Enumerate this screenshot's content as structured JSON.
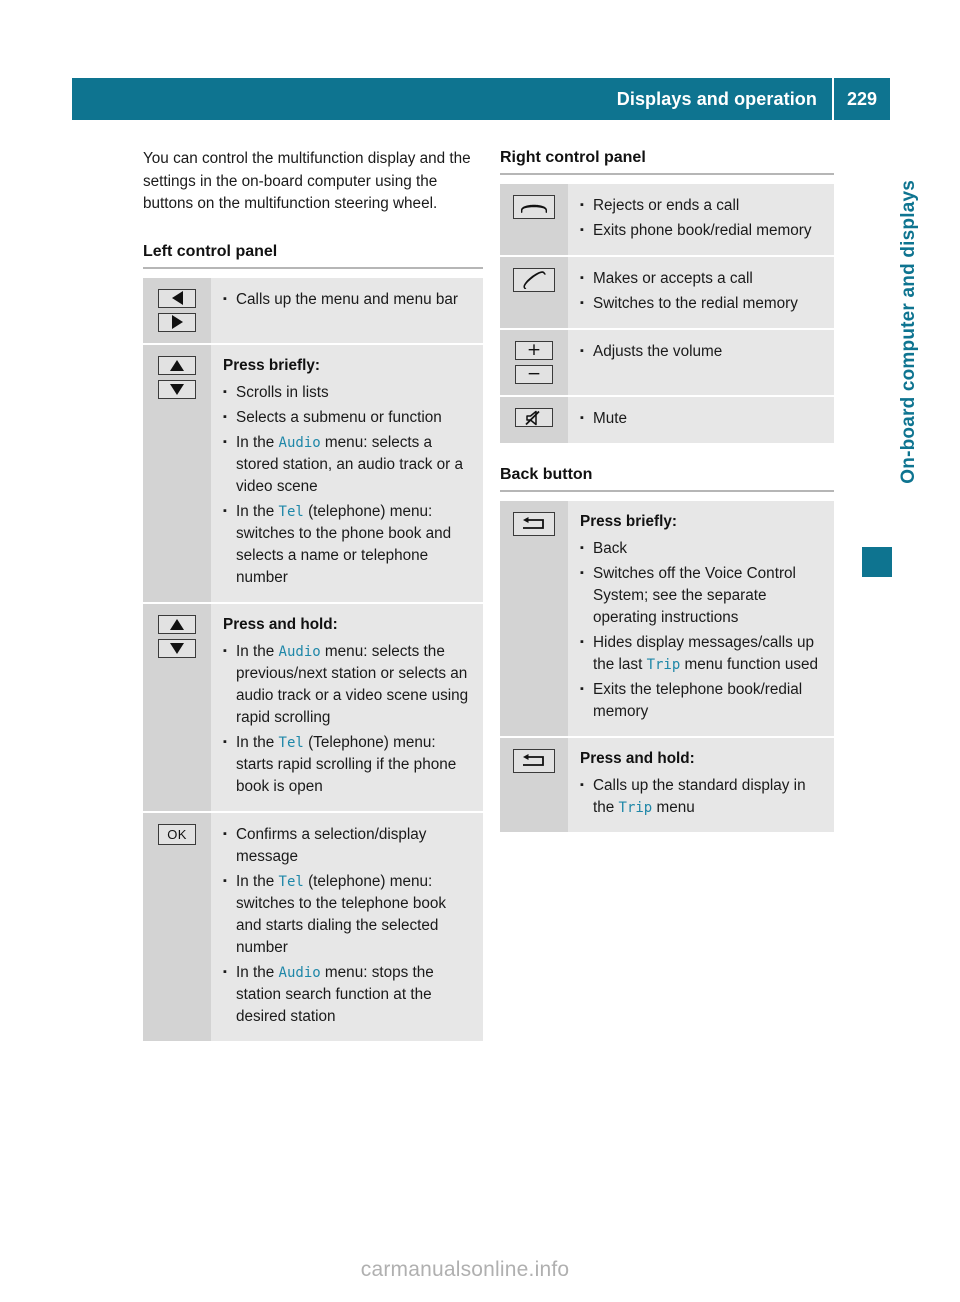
{
  "header": {
    "title": "Displays and operation",
    "page_number": "229",
    "bar_color": "#0e7490"
  },
  "side_tab": {
    "label": "On-board computer and displays",
    "color": "#0e7490"
  },
  "footer": {
    "watermark": "carmanualsonline.info"
  },
  "left_column": {
    "intro": "You can control the multifunction display and the settings in the on-board computer using the buttons on the multifunction steering wheel.",
    "section_heading": "Left control panel",
    "rows": [
      {
        "icons": [
          "triangle-left-button",
          "triangle-right-button"
        ],
        "press_label": "",
        "bullets": [
          {
            "parts": [
              {
                "text": "Calls up the menu and menu bar",
                "style": "normal"
              }
            ]
          }
        ]
      },
      {
        "icons": [
          "triangle-up-button",
          "triangle-down-button"
        ],
        "press_label": "Press briefly:",
        "bullets": [
          {
            "parts": [
              {
                "text": "Scrolls in lists",
                "style": "normal"
              }
            ]
          },
          {
            "parts": [
              {
                "text": "Selects a submenu or function",
                "style": "normal"
              }
            ]
          },
          {
            "parts": [
              {
                "text": "In the ",
                "style": "normal"
              },
              {
                "text": "Audio",
                "style": "mono"
              },
              {
                "text": " menu: selects a stored station, an audio track or a video scene",
                "style": "normal"
              }
            ]
          },
          {
            "parts": [
              {
                "text": "In the ",
                "style": "normal"
              },
              {
                "text": "Tel",
                "style": "mono"
              },
              {
                "text": " (telephone) menu: switches to the phone book and selects a name or telephone number",
                "style": "normal"
              }
            ]
          }
        ]
      },
      {
        "icons": [
          "triangle-up-button",
          "triangle-down-button"
        ],
        "press_label": "Press and hold:",
        "bullets": [
          {
            "parts": [
              {
                "text": "In the ",
                "style": "normal"
              },
              {
                "text": "Audio",
                "style": "mono"
              },
              {
                "text": " menu: selects the previous/next station or selects an audio track or a video scene using rapid scrolling",
                "style": "normal"
              }
            ]
          },
          {
            "parts": [
              {
                "text": "In the ",
                "style": "normal"
              },
              {
                "text": "Tel",
                "style": "mono"
              },
              {
                "text": " (Telephone) menu: starts rapid scrolling if the phone book is open",
                "style": "normal"
              }
            ]
          }
        ]
      },
      {
        "icons": [
          "ok-button"
        ],
        "press_label": "",
        "bullets": [
          {
            "parts": [
              {
                "text": "Confirms a selection/display message",
                "style": "normal"
              }
            ]
          },
          {
            "parts": [
              {
                "text": "In the ",
                "style": "normal"
              },
              {
                "text": "Tel",
                "style": "mono"
              },
              {
                "text": " (telephone) menu: switches to the telephone book and starts dialing the selected number",
                "style": "normal"
              }
            ]
          },
          {
            "parts": [
              {
                "text": "In the ",
                "style": "normal"
              },
              {
                "text": "Audio",
                "style": "mono"
              },
              {
                "text": " menu: stops the station search function at the desired station",
                "style": "normal"
              }
            ]
          }
        ]
      }
    ]
  },
  "right_column": {
    "sections": [
      {
        "heading": "Right control panel",
        "rows": [
          {
            "icons": [
              "end-call-button"
            ],
            "press_label": "",
            "bullets": [
              {
                "parts": [
                  {
                    "text": "Rejects or ends a call",
                    "style": "normal"
                  }
                ]
              },
              {
                "parts": [
                  {
                    "text": "Exits phone book/redial memory",
                    "style": "normal"
                  }
                ]
              }
            ]
          },
          {
            "icons": [
              "accept-call-button"
            ],
            "press_label": "",
            "bullets": [
              {
                "parts": [
                  {
                    "text": "Makes or accepts a call",
                    "style": "normal"
                  }
                ]
              },
              {
                "parts": [
                  {
                    "text": "Switches to the redial memory",
                    "style": "normal"
                  }
                ]
              }
            ]
          },
          {
            "icons": [
              "volume-up-button",
              "volume-down-button"
            ],
            "press_label": "",
            "bullets": [
              {
                "parts": [
                  {
                    "text": "Adjusts the volume",
                    "style": "normal"
                  }
                ]
              }
            ]
          },
          {
            "icons": [
              "mute-button"
            ],
            "press_label": "",
            "bullets": [
              {
                "parts": [
                  {
                    "text": "Mute",
                    "style": "normal"
                  }
                ]
              }
            ]
          }
        ]
      },
      {
        "heading": "Back button",
        "rows": [
          {
            "icons": [
              "back-button"
            ],
            "press_label": "Press briefly:",
            "bullets": [
              {
                "parts": [
                  {
                    "text": "Back",
                    "style": "normal"
                  }
                ]
              },
              {
                "parts": [
                  {
                    "text": "Switches off the Voice Control System; see the separate operating instructions",
                    "style": "normal"
                  }
                ]
              },
              {
                "parts": [
                  {
                    "text": "Hides display messages/calls up the last ",
                    "style": "normal"
                  },
                  {
                    "text": "Trip",
                    "style": "mono"
                  },
                  {
                    "text": " menu function used",
                    "style": "normal"
                  }
                ]
              },
              {
                "parts": [
                  {
                    "text": "Exits the telephone book/redial memory",
                    "style": "normal"
                  }
                ]
              }
            ]
          },
          {
            "icons": [
              "back-button"
            ],
            "press_label": "Press and hold:",
            "bullets": [
              {
                "parts": [
                  {
                    "text": "Calls up the standard display in the ",
                    "style": "normal"
                  },
                  {
                    "text": "Trip",
                    "style": "mono"
                  },
                  {
                    "text": " menu",
                    "style": "normal"
                  }
                ]
              }
            ]
          }
        ]
      }
    ]
  }
}
